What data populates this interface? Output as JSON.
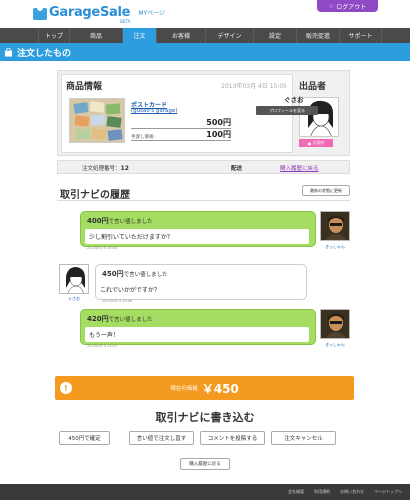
{
  "header": {
    "logo_text": "GarageSale",
    "logo_beta": "BETA",
    "mypage": "MYページ",
    "logout": "ログアウト"
  },
  "nav": {
    "items": [
      "トップ",
      "商品",
      "注文",
      "お客様",
      "デザイン",
      "設定",
      "販売促進",
      "サポート"
    ],
    "active": "注文"
  },
  "page_title": "注文したもの",
  "item": {
    "heading": "商品情報",
    "date": "2013年03月 4日 15:05",
    "name": "ポストカード",
    "shop": "(gusao's garage)",
    "price": "500円",
    "shipping_label": "手渡し価格:",
    "shipping_value": "100円"
  },
  "seller": {
    "heading": "出品者",
    "name": "ぐさお",
    "profile_btn": "プロフィールを見る",
    "badge": "大阪府"
  },
  "order": {
    "number_label": "注文処理番号：",
    "number_value": "12",
    "status": "配送",
    "back_link": "購入履歴に戻る"
  },
  "history": {
    "title": "取引ナビの履歴",
    "refresh": "最新の状態に更新",
    "messages": [
      {
        "amount": "400円",
        "suffix": "で言い値しました",
        "body": "少し割引いていただけますか？",
        "time": "2013/03/ 4 15:05",
        "user": "きっしゃん"
      },
      {
        "amount": "450円",
        "suffix": "で言い値しました",
        "body": "これでいかがですか？",
        "time": "2013/03/ 4 15:06",
        "user": "ぐさお"
      },
      {
        "amount": "420円",
        "suffix": "で言い値しました",
        "body": "もう一声！",
        "time": "2013/03/ 4 15:07",
        "user": "きっしゃん"
      }
    ]
  },
  "current_price": {
    "label": "現在の価格",
    "value": "￥450"
  },
  "write": {
    "title": "取引ナビに書き込む",
    "buttons": [
      "450円で確定",
      "言い値で注文し直す",
      "コメントを投稿する",
      "注文キャンセル"
    ],
    "back": "購入履歴に戻る"
  },
  "footer": {
    "links": [
      "会社概要",
      "利用規約",
      "お問い合わせ",
      "ページトップへ"
    ]
  },
  "colors": {
    "accent": "#2d9de0",
    "nav_bg": "#4a4a4a",
    "logout": "#8e49c4",
    "price_bar": "#f49b1f",
    "bubble_green": "#a5dc62"
  }
}
